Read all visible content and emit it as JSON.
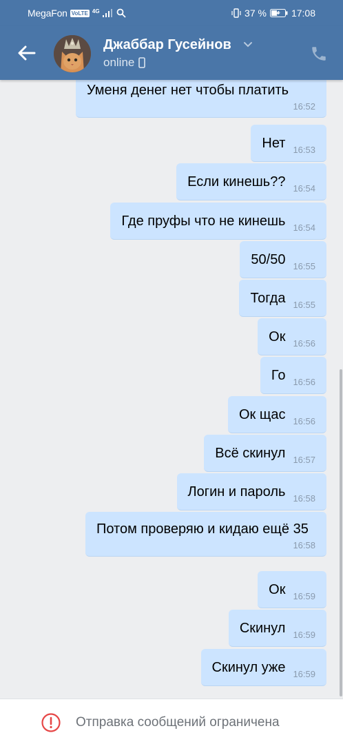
{
  "status_bar": {
    "carrier": "MegaFon",
    "volte": "VoLTE",
    "network": "4G",
    "battery_percent": "37 %",
    "time": "17:08"
  },
  "header": {
    "contact_name": "Джаббар Гусейнов",
    "contact_status": "online",
    "icons": [
      "back-arrow-icon",
      "chevron-down-icon",
      "mobile-icon",
      "phone-icon"
    ]
  },
  "messages": [
    {
      "text": "Уменя денег нет чтобы платить",
      "time": "16:52"
    },
    {
      "text": "Нет",
      "time": "16:53"
    },
    {
      "text": "Если кинешь??",
      "time": "16:54"
    },
    {
      "text": "Где пруфы что не кинешь",
      "time": "16:54"
    },
    {
      "text": "50/50",
      "time": "16:55"
    },
    {
      "text": "Тогда",
      "time": "16:55"
    },
    {
      "text": "Ок",
      "time": "16:56"
    },
    {
      "text": "Го",
      "time": "16:56"
    },
    {
      "text": "Ок щас",
      "time": "16:56"
    },
    {
      "text": "Всё скинул",
      "time": "16:57"
    },
    {
      "text": "Логин и пароль",
      "time": "16:58"
    },
    {
      "text": "Потом проверяю и кидаю ещё 35",
      "time": "16:58"
    },
    {
      "text": "Ок",
      "time": "16:59"
    },
    {
      "text": "Скинул",
      "time": "16:59"
    },
    {
      "text": "Скинул уже",
      "time": "16:59"
    }
  ],
  "bottom_bar": {
    "restriction_text": "Отправка сообщений ограничена"
  },
  "colors": {
    "header_bg": "#4a76a8",
    "bubble_bg": "#cce4ff",
    "chat_bg": "#edeef0",
    "warning": "#e64646"
  }
}
